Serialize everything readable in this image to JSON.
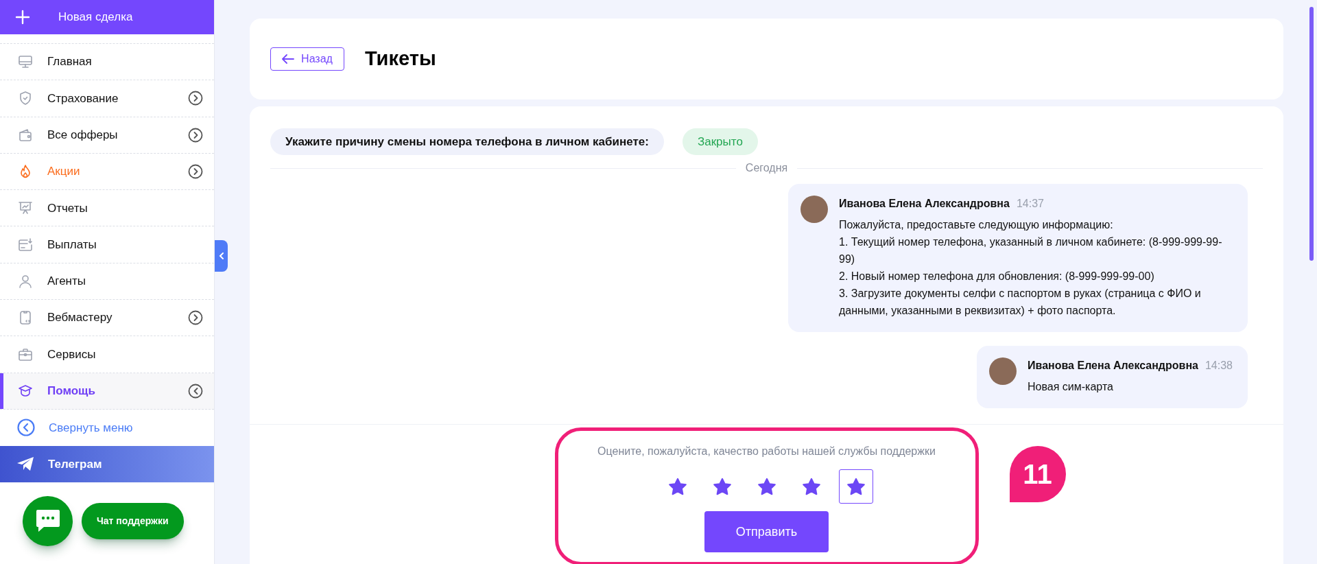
{
  "sidebar": {
    "new_deal": "Новая сделка",
    "items": [
      {
        "label": "Главная",
        "kind": "normal",
        "selected": false
      },
      {
        "label": "Страхование",
        "kind": "normal",
        "expanded": false,
        "selected": false
      },
      {
        "label": "Все офферы",
        "kind": "normal",
        "expanded": false,
        "selected": false
      },
      {
        "label": "Акции",
        "kind": "promo",
        "expanded": false,
        "selected": false
      },
      {
        "label": "Отчеты",
        "kind": "normal",
        "selected": false
      },
      {
        "label": "Выплаты",
        "kind": "normal",
        "selected": false
      },
      {
        "label": "Агенты",
        "kind": "normal",
        "selected": false
      },
      {
        "label": "Вебмастеру",
        "kind": "normal",
        "expanded": false,
        "selected": false
      },
      {
        "label": "Сервисы",
        "kind": "normal",
        "selected": false
      },
      {
        "label": "Помощь",
        "kind": "normal",
        "expanded": true,
        "selected": true
      }
    ],
    "collapse": "Свернуть меню",
    "telegram": "Телеграм",
    "support_chat": "Чат поддержки"
  },
  "header": {
    "back": "Назад",
    "title": "Тикеты"
  },
  "ticket": {
    "subject": "Укажите причину смены номера телефона в личном кабинете:",
    "status": "Закрыто",
    "date_divider": "Сегодня",
    "messages": [
      {
        "author": "Иванова Елена Александровна",
        "time": "14:37",
        "lines": [
          "Пожалуйста, предоставьте следующую информацию:",
          "1. Текущий номер телефона, указанный в личном кабинете: (8-999-999-99-99)",
          "2. Новый номер телефона для обновления: (8-999-999-99-00)",
          "3. Загрузите документы селфи с паспортом в руках (страница с ФИО и данными, указанными в реквизитах) + фото паспорта."
        ]
      },
      {
        "author": "Иванова Елена Александровна",
        "time": "14:38",
        "lines": [
          "Новая сим-карта"
        ]
      }
    ]
  },
  "rating": {
    "prompt": "Оцените, пожалуйста, качество работы нашей службы поддержки",
    "stars": 5,
    "submit": "Отправить"
  },
  "annotation": {
    "number": "11"
  }
}
